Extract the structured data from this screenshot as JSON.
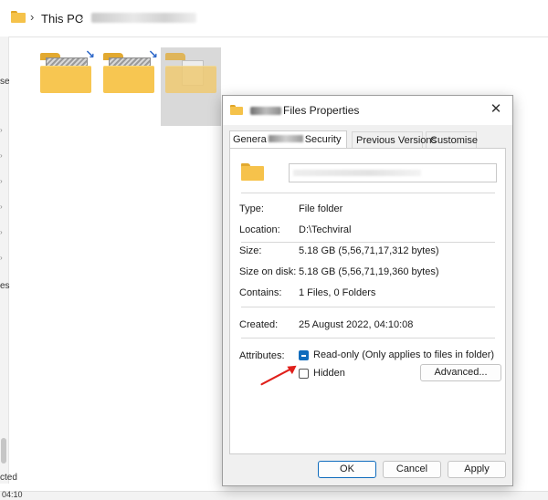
{
  "explorer": {
    "breadcrumb": {
      "this_pc": "This PC"
    },
    "status": {
      "items_text": "cted",
      "time_text": "04:10"
    },
    "nav_fragments": [
      "se",
      "es"
    ]
  },
  "dialog": {
    "title_suffix": "Files Properties",
    "tabs": {
      "general_prefix": "Genera",
      "general_suffix": "Security",
      "previous_versions": "Previous Versions",
      "customise": "Customise"
    },
    "properties": {
      "type_label": "Type:",
      "type_value": "File folder",
      "location_label": "Location:",
      "location_value": "D:\\Techviral",
      "size_label": "Size:",
      "size_value": "5.18 GB (5,56,71,17,312 bytes)",
      "size_on_disk_label": "Size on disk:",
      "size_on_disk_value": "5.18 GB (5,56,71,19,360 bytes)",
      "contains_label": "Contains:",
      "contains_value": "1 Files, 0 Folders",
      "created_label": "Created:",
      "created_value": "25 August 2022, 04:10:08",
      "attributes_label": "Attributes:",
      "readonly_label": "Read-only (Only applies to files in folder)",
      "hidden_label": "Hidden",
      "advanced_label": "Advanced..."
    },
    "buttons": {
      "ok": "OK",
      "cancel": "Cancel",
      "apply": "Apply"
    },
    "close_icon": "✕"
  },
  "colors": {
    "accent": "#0f6cbd",
    "annotation_arrow": "#e0201b",
    "folder": "#f6c24b"
  }
}
